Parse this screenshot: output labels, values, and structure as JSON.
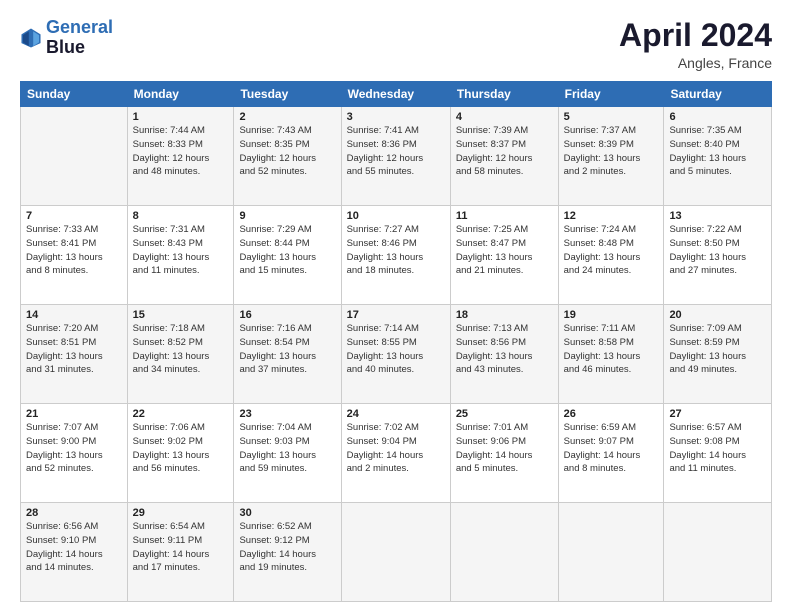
{
  "header": {
    "logo_line1": "General",
    "logo_line2": "Blue",
    "title": "April 2024",
    "subtitle": "Angles, France"
  },
  "columns": [
    "Sunday",
    "Monday",
    "Tuesday",
    "Wednesday",
    "Thursday",
    "Friday",
    "Saturday"
  ],
  "weeks": [
    [
      {
        "day": "",
        "info": ""
      },
      {
        "day": "1",
        "info": "Sunrise: 7:44 AM\nSunset: 8:33 PM\nDaylight: 12 hours\nand 48 minutes."
      },
      {
        "day": "2",
        "info": "Sunrise: 7:43 AM\nSunset: 8:35 PM\nDaylight: 12 hours\nand 52 minutes."
      },
      {
        "day": "3",
        "info": "Sunrise: 7:41 AM\nSunset: 8:36 PM\nDaylight: 12 hours\nand 55 minutes."
      },
      {
        "day": "4",
        "info": "Sunrise: 7:39 AM\nSunset: 8:37 PM\nDaylight: 12 hours\nand 58 minutes."
      },
      {
        "day": "5",
        "info": "Sunrise: 7:37 AM\nSunset: 8:39 PM\nDaylight: 13 hours\nand 2 minutes."
      },
      {
        "day": "6",
        "info": "Sunrise: 7:35 AM\nSunset: 8:40 PM\nDaylight: 13 hours\nand 5 minutes."
      }
    ],
    [
      {
        "day": "7",
        "info": "Sunrise: 7:33 AM\nSunset: 8:41 PM\nDaylight: 13 hours\nand 8 minutes."
      },
      {
        "day": "8",
        "info": "Sunrise: 7:31 AM\nSunset: 8:43 PM\nDaylight: 13 hours\nand 11 minutes."
      },
      {
        "day": "9",
        "info": "Sunrise: 7:29 AM\nSunset: 8:44 PM\nDaylight: 13 hours\nand 15 minutes."
      },
      {
        "day": "10",
        "info": "Sunrise: 7:27 AM\nSunset: 8:46 PM\nDaylight: 13 hours\nand 18 minutes."
      },
      {
        "day": "11",
        "info": "Sunrise: 7:25 AM\nSunset: 8:47 PM\nDaylight: 13 hours\nand 21 minutes."
      },
      {
        "day": "12",
        "info": "Sunrise: 7:24 AM\nSunset: 8:48 PM\nDaylight: 13 hours\nand 24 minutes."
      },
      {
        "day": "13",
        "info": "Sunrise: 7:22 AM\nSunset: 8:50 PM\nDaylight: 13 hours\nand 27 minutes."
      }
    ],
    [
      {
        "day": "14",
        "info": "Sunrise: 7:20 AM\nSunset: 8:51 PM\nDaylight: 13 hours\nand 31 minutes."
      },
      {
        "day": "15",
        "info": "Sunrise: 7:18 AM\nSunset: 8:52 PM\nDaylight: 13 hours\nand 34 minutes."
      },
      {
        "day": "16",
        "info": "Sunrise: 7:16 AM\nSunset: 8:54 PM\nDaylight: 13 hours\nand 37 minutes."
      },
      {
        "day": "17",
        "info": "Sunrise: 7:14 AM\nSunset: 8:55 PM\nDaylight: 13 hours\nand 40 minutes."
      },
      {
        "day": "18",
        "info": "Sunrise: 7:13 AM\nSunset: 8:56 PM\nDaylight: 13 hours\nand 43 minutes."
      },
      {
        "day": "19",
        "info": "Sunrise: 7:11 AM\nSunset: 8:58 PM\nDaylight: 13 hours\nand 46 minutes."
      },
      {
        "day": "20",
        "info": "Sunrise: 7:09 AM\nSunset: 8:59 PM\nDaylight: 13 hours\nand 49 minutes."
      }
    ],
    [
      {
        "day": "21",
        "info": "Sunrise: 7:07 AM\nSunset: 9:00 PM\nDaylight: 13 hours\nand 52 minutes."
      },
      {
        "day": "22",
        "info": "Sunrise: 7:06 AM\nSunset: 9:02 PM\nDaylight: 13 hours\nand 56 minutes."
      },
      {
        "day": "23",
        "info": "Sunrise: 7:04 AM\nSunset: 9:03 PM\nDaylight: 13 hours\nand 59 minutes."
      },
      {
        "day": "24",
        "info": "Sunrise: 7:02 AM\nSunset: 9:04 PM\nDaylight: 14 hours\nand 2 minutes."
      },
      {
        "day": "25",
        "info": "Sunrise: 7:01 AM\nSunset: 9:06 PM\nDaylight: 14 hours\nand 5 minutes."
      },
      {
        "day": "26",
        "info": "Sunrise: 6:59 AM\nSunset: 9:07 PM\nDaylight: 14 hours\nand 8 minutes."
      },
      {
        "day": "27",
        "info": "Sunrise: 6:57 AM\nSunset: 9:08 PM\nDaylight: 14 hours\nand 11 minutes."
      }
    ],
    [
      {
        "day": "28",
        "info": "Sunrise: 6:56 AM\nSunset: 9:10 PM\nDaylight: 14 hours\nand 14 minutes."
      },
      {
        "day": "29",
        "info": "Sunrise: 6:54 AM\nSunset: 9:11 PM\nDaylight: 14 hours\nand 17 minutes."
      },
      {
        "day": "30",
        "info": "Sunrise: 6:52 AM\nSunset: 9:12 PM\nDaylight: 14 hours\nand 19 minutes."
      },
      {
        "day": "",
        "info": ""
      },
      {
        "day": "",
        "info": ""
      },
      {
        "day": "",
        "info": ""
      },
      {
        "day": "",
        "info": ""
      }
    ]
  ]
}
